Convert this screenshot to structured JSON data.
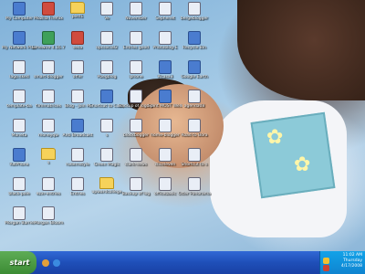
{
  "desktop": {
    "icons": [
      {
        "name": "My Computer",
        "kind": "app"
      },
      {
        "name": "Mozilla Firefox",
        "kind": "red"
      },
      {
        "name": "post1",
        "kind": "folder"
      },
      {
        "name": "Ve",
        "kind": "doc"
      },
      {
        "name": "November",
        "kind": "doc"
      },
      {
        "name": "Sephenet",
        "kind": "doc"
      },
      {
        "name": "bergeblogger",
        "kind": "doc"
      },
      {
        "name": "My Network Places",
        "kind": "app"
      },
      {
        "name": "Limewire 4.16.7",
        "kind": "green"
      },
      {
        "name": "sesa",
        "kind": "red"
      },
      {
        "name": "opcsocial2",
        "kind": "doc"
      },
      {
        "name": "Entries good",
        "kind": "doc"
      },
      {
        "name": "Photoblog-E",
        "kind": "doc"
      },
      {
        "name": "Recycle Bin",
        "kind": "app"
      },
      {
        "name": "lago.sked",
        "kind": "doc"
      },
      {
        "name": "smart-blogger",
        "kind": "doc"
      },
      {
        "name": "offer",
        "kind": "doc"
      },
      {
        "name": "Pbegblog",
        "kind": "doc"
      },
      {
        "name": "iphone",
        "kind": "doc"
      },
      {
        "name": "Picasa3",
        "kind": "app"
      },
      {
        "name": "Google Earth",
        "kind": "app"
      },
      {
        "name": "template-ba",
        "kind": "doc"
      },
      {
        "name": "filmmatrices",
        "kind": "doc"
      },
      {
        "name": "Blog - Join M",
        "kind": "doc"
      },
      {
        "name": "Shortcut to Computer",
        "kind": "app"
      },
      {
        "name": "Backup of logo sked",
        "kind": "doc"
      },
      {
        "name": "Spirit MOST Wellness",
        "kind": "app"
      },
      {
        "name": "agenda08",
        "kind": "doc"
      },
      {
        "name": "Moneta",
        "kind": "doc"
      },
      {
        "name": "moneyqw",
        "kind": "doc"
      },
      {
        "name": "Anti Broadcast",
        "kind": "app"
      },
      {
        "name": "s",
        "kind": "doc"
      },
      {
        "name": "blockbogger",
        "kind": "doc"
      },
      {
        "name": "home-blogger",
        "kind": "doc"
      },
      {
        "name": "Road to Bora",
        "kind": "doc"
      },
      {
        "name": "RelPhone",
        "kind": "app"
      },
      {
        "name": "s",
        "kind": "folder"
      },
      {
        "name": "rudernstyle",
        "kind": "doc"
      },
      {
        "name": "Green Magic",
        "kind": "doc"
      },
      {
        "name": "clark-news",
        "kind": "doc"
      },
      {
        "name": "cliceleven",
        "kind": "doc"
      },
      {
        "name": "Shortcut to s",
        "kind": "doc"
      },
      {
        "name": "black-pale",
        "kind": "doc"
      },
      {
        "name": "ezxr-entries",
        "kind": "doc"
      },
      {
        "name": "Entries",
        "kind": "doc"
      },
      {
        "name": "upwardcollege",
        "kind": "folder"
      },
      {
        "name": "Backup of log",
        "kind": "doc"
      },
      {
        "name": "officebasic",
        "kind": "doc"
      },
      {
        "name": "Otter Panorama",
        "kind": "doc"
      },
      {
        "name": "Morgan Barrie",
        "kind": "doc"
      },
      {
        "name": "Morgan Bloom",
        "kind": "doc"
      }
    ]
  },
  "taskbar": {
    "start_label": "start",
    "clock_time": "11:02 AM",
    "clock_day": "Thursday",
    "clock_date": "4/17/2008"
  }
}
